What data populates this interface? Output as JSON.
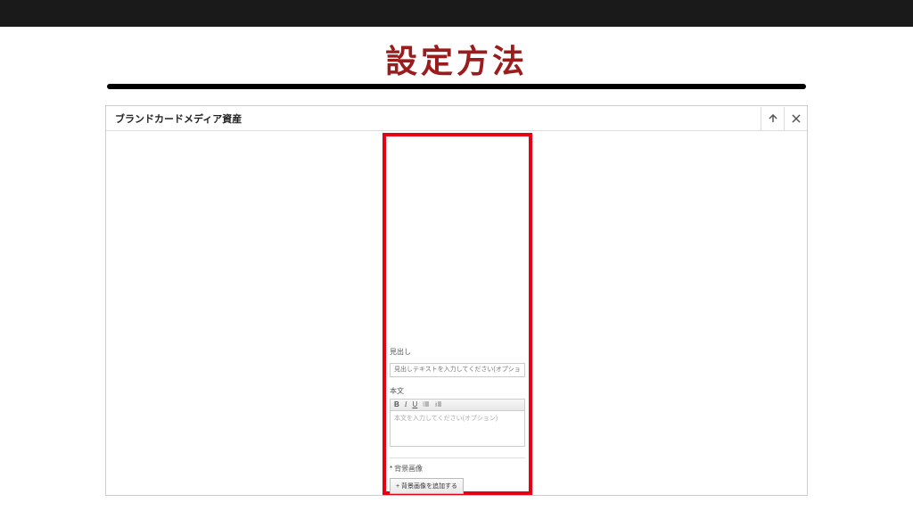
{
  "page": {
    "heading": "設定方法"
  },
  "panel": {
    "title": "ブランドカードメディア資産"
  },
  "form": {
    "headline": {
      "label": "見出し",
      "placeholder": "見出しテキストを入力してください(オプション)"
    },
    "body": {
      "label": "本文",
      "placeholder": "本文を入力してください(オプション)"
    },
    "bg": {
      "label": "背景画像",
      "button": "+ 背景画像を追加する"
    }
  },
  "rte": {
    "bold": "B",
    "italic": "I",
    "underline": "U"
  }
}
